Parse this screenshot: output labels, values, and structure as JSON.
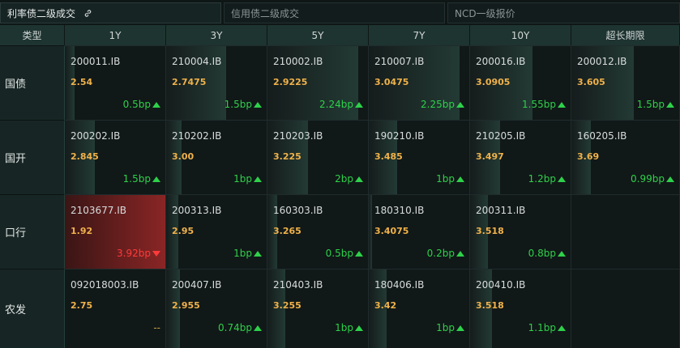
{
  "tabs": [
    {
      "label": "利率债二级成交",
      "active": true
    },
    {
      "label": "信用债二级成交",
      "active": false
    },
    {
      "label": "NCD一级报价",
      "active": false
    }
  ],
  "columns": [
    "类型",
    "1Y",
    "3Y",
    "5Y",
    "7Y",
    "10Y",
    "超长期限"
  ],
  "rows": [
    {
      "label": "国债",
      "cells": [
        {
          "code": "200011.IB",
          "rate": "2.54",
          "change": "0.5bp",
          "dir": "up",
          "bar": 0.1
        },
        {
          "code": "210004.IB",
          "rate": "2.7475",
          "change": "1.5bp",
          "dir": "up",
          "bar": 0.6
        },
        {
          "code": "210002.IB",
          "rate": "2.9225",
          "change": "2.24bp",
          "dir": "up",
          "bar": 0.9
        },
        {
          "code": "210007.IB",
          "rate": "3.0475",
          "change": "2.25bp",
          "dir": "up",
          "bar": 0.9
        },
        {
          "code": "200016.IB",
          "rate": "3.0905",
          "change": "1.55bp",
          "dir": "up",
          "bar": 0.62
        },
        {
          "code": "200012.IB",
          "rate": "3.605",
          "change": "1.5bp",
          "dir": "up",
          "bar": 0.58
        }
      ]
    },
    {
      "label": "国开",
      "cells": [
        {
          "code": "200202.IB",
          "rate": "2.845",
          "change": "1.5bp",
          "dir": "up",
          "bar": 0.3
        },
        {
          "code": "210202.IB",
          "rate": "3.00",
          "change": "1bp",
          "dir": "up",
          "bar": 0.15
        },
        {
          "code": "210203.IB",
          "rate": "3.225",
          "change": "2bp",
          "dir": "up",
          "bar": 0.4
        },
        {
          "code": "190210.IB",
          "rate": "3.485",
          "change": "1bp",
          "dir": "up",
          "bar": 0.28
        },
        {
          "code": "210205.IB",
          "rate": "3.497",
          "change": "1.2bp",
          "dir": "up",
          "bar": 0.3
        },
        {
          "code": "160205.IB",
          "rate": "3.69",
          "change": "0.99bp",
          "dir": "up",
          "bar": 0.18
        }
      ]
    },
    {
      "label": "口行",
      "cells": [
        {
          "code": "2103677.IB",
          "rate": "1.92",
          "change": "3.92bp",
          "dir": "down",
          "bar": 1.0
        },
        {
          "code": "200313.IB",
          "rate": "2.95",
          "change": "1bp",
          "dir": "up",
          "bar": 0.12
        },
        {
          "code": "160303.IB",
          "rate": "3.265",
          "change": "0.5bp",
          "dir": "up",
          "bar": 0.1
        },
        {
          "code": "180310.IB",
          "rate": "3.4075",
          "change": "0.2bp",
          "dir": "up",
          "bar": 0.03
        },
        {
          "code": "200311.IB",
          "rate": "3.518",
          "change": "0.8bp",
          "dir": "up",
          "bar": 0.18
        },
        null
      ]
    },
    {
      "label": "农发",
      "cells": [
        {
          "code": "092018003.IB",
          "rate": "2.75",
          "change": "--",
          "dir": "flat",
          "bar": 0
        },
        {
          "code": "200407.IB",
          "rate": "2.955",
          "change": "0.74bp",
          "dir": "up",
          "bar": 0.14
        },
        {
          "code": "210403.IB",
          "rate": "3.255",
          "change": "1bp",
          "dir": "up",
          "bar": 0.18
        },
        {
          "code": "180406.IB",
          "rate": "3.42",
          "change": "1bp",
          "dir": "up",
          "bar": 0.18
        },
        {
          "code": "200410.IB",
          "rate": "3.518",
          "change": "1.1bp",
          "dir": "up",
          "bar": 0.22
        },
        null
      ]
    }
  ]
}
